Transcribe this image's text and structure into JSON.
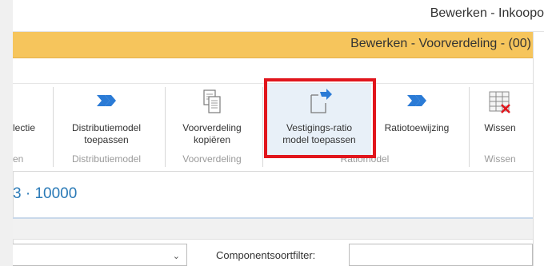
{
  "window": {
    "outer_title": "Bewerken - Inkoopo",
    "inner_title": "Bewerken - Voorverdeling - (00)"
  },
  "ribbon": {
    "buttons": [
      {
        "label": "lectie",
        "icon": "none"
      },
      {
        "label": "Distributiemodel\ntoepassen",
        "icon": "arrow-right-icon"
      },
      {
        "label": "Voorverdeling\nkopiëren",
        "icon": "copy-document-icon"
      },
      {
        "label": "Vestigings-ratio\nmodel toepassen",
        "icon": "document-arrow-icon",
        "highlighted": true
      },
      {
        "label": "Ratiotoewijzing",
        "icon": "arrow-right-icon"
      },
      {
        "label": "Wissen",
        "icon": "clear-grid-icon"
      }
    ],
    "groups": [
      {
        "label": "en"
      },
      {
        "label": "Distributiemodel"
      },
      {
        "label": "Voorverdeling"
      },
      {
        "label": "Ratiomodel"
      },
      {
        "label": "Wissen"
      }
    ]
  },
  "record": {
    "title": "3 · 10000"
  },
  "filters": {
    "dropdown_icon": "chevron-down-icon",
    "component_type_filter_label": "Componentsoortfilter:",
    "component_type_filter_value": ""
  },
  "colors": {
    "inner_titlebar": "#f6c55c",
    "accent_blue": "#2a7ab7",
    "highlight_box": "#e1151c",
    "icon_blue": "#2b7bd6"
  }
}
